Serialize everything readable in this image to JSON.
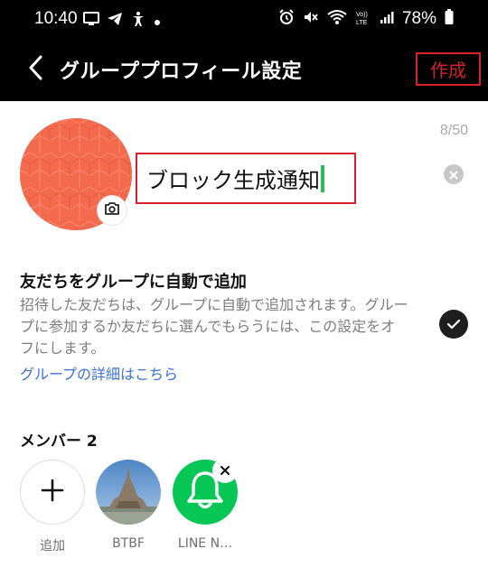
{
  "status_bar": {
    "time": "10:40",
    "battery": "78%",
    "left_icons": [
      "screen-icon",
      "telegram-icon",
      "accessibility-icon",
      "dot-icon"
    ],
    "right_icons": [
      "alarm-icon",
      "mute-icon",
      "wifi-icon",
      "volte-icon",
      "signal-icon",
      "battery-icon"
    ]
  },
  "header": {
    "title": "グループプロフィール設定",
    "create_label": "作成"
  },
  "profile": {
    "char_count": "8/50",
    "name_value": "ブロック生成通知"
  },
  "auto_add": {
    "title": "友だちをグループに自動で追加",
    "description": "招待した友だちは、グループに自動で追加されます。グループに参加するか友だちに選んでもらうには、この設定をオフにします。",
    "link": "グループの詳細はこちら",
    "checked": true
  },
  "members": {
    "title": "メンバー 2",
    "items": [
      {
        "label": "追加",
        "type": "add"
      },
      {
        "label": "BTBF",
        "type": "photo"
      },
      {
        "label": "LINE N…",
        "type": "bell"
      }
    ]
  },
  "colors": {
    "accent_red": "#d8202b",
    "avatar": "#f46a4e",
    "link_blue": "#3c72d9",
    "line_green": "#06c755",
    "caret_green": "#2ebd4f"
  }
}
